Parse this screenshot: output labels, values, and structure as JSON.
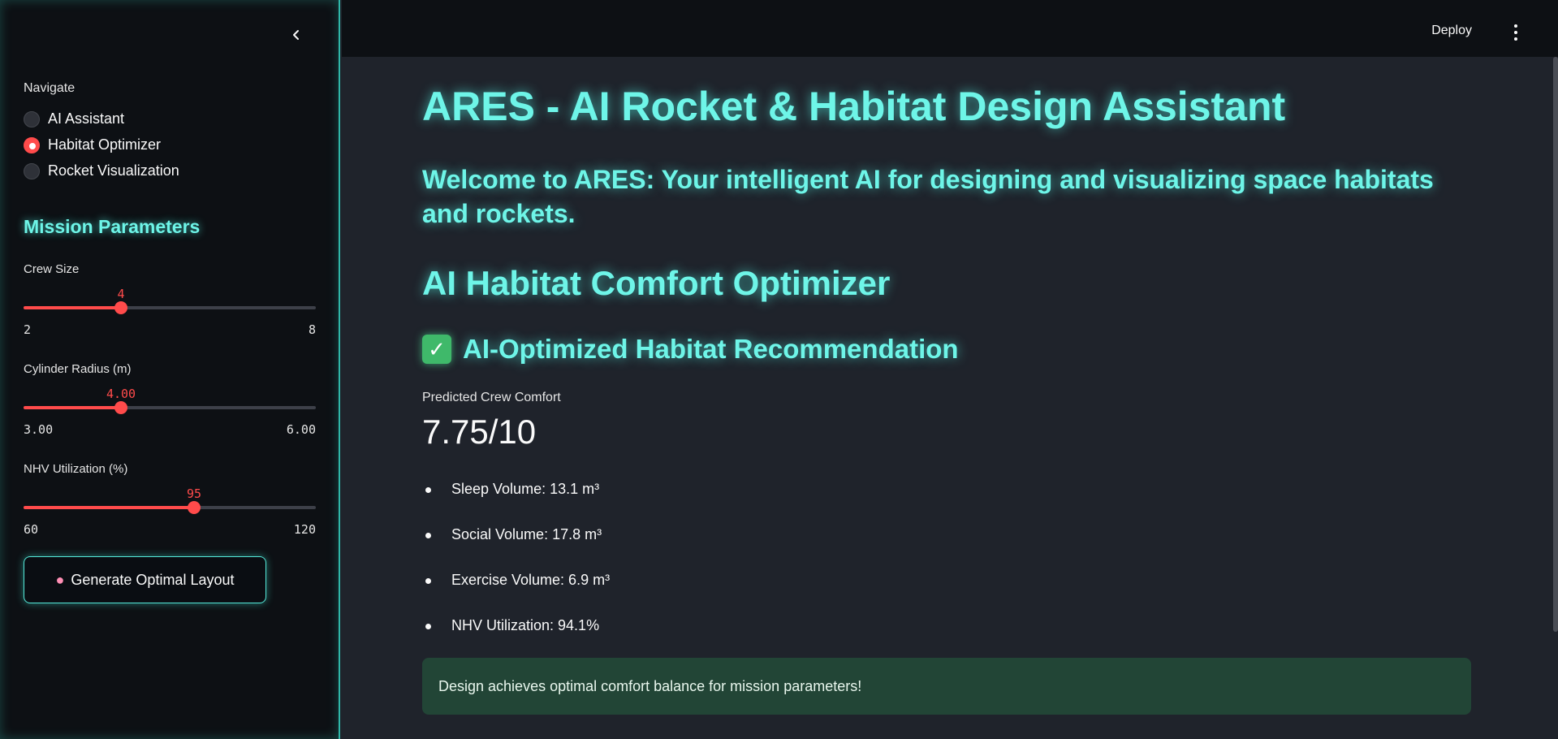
{
  "sidebar": {
    "nav_label": "Navigate",
    "nav_options": [
      {
        "label": "AI Assistant",
        "selected": false
      },
      {
        "label": "Habitat Optimizer",
        "selected": true
      },
      {
        "label": "Rocket Visualization",
        "selected": false
      }
    ],
    "section_title": "Mission Parameters",
    "sliders": [
      {
        "label": "Crew Size",
        "value": 4,
        "value_text": "4",
        "min": 2,
        "max": 8,
        "min_text": "2",
        "max_text": "8"
      },
      {
        "label": "Cylinder Radius (m)",
        "value": 4.0,
        "value_text": "4.00",
        "min": 3.0,
        "max": 6.0,
        "min_text": "3.00",
        "max_text": "6.00"
      },
      {
        "label": "NHV Utilization (%)",
        "value": 95,
        "value_text": "95",
        "min": 60,
        "max": 120,
        "min_text": "60",
        "max_text": "120"
      }
    ],
    "generate_button": {
      "icon": "brain-icon",
      "label": "Generate Optimal Layout"
    }
  },
  "header": {
    "deploy_label": "Deploy",
    "menu_icon": "kebab-menu-icon"
  },
  "main": {
    "title": "ARES - AI Rocket & Habitat Design Assistant",
    "welcome": "Welcome to ARES: Your intelligent AI for designing and visualizing space habitats and rockets.",
    "section_title": "AI Habitat Comfort Optimizer",
    "recommendation_title": "AI-Optimized Habitat Recommendation",
    "metric": {
      "label": "Predicted Crew Comfort",
      "value": "7.75/10"
    },
    "bullets": [
      "Sleep Volume: 13.1 m³",
      "Social Volume: 17.8 m³",
      "Exercise Volume: 6.9 m³",
      "NHV Utilization: 94.1%"
    ],
    "success_message": "Design achieves optimal comfort balance for mission parameters!"
  },
  "colors": {
    "accent_cyan": "#6ef5e8",
    "slider_red": "#ff4b4b",
    "success_bg": "#224536",
    "background": "#1f232b",
    "sidebar_bg": "#0d1014"
  }
}
